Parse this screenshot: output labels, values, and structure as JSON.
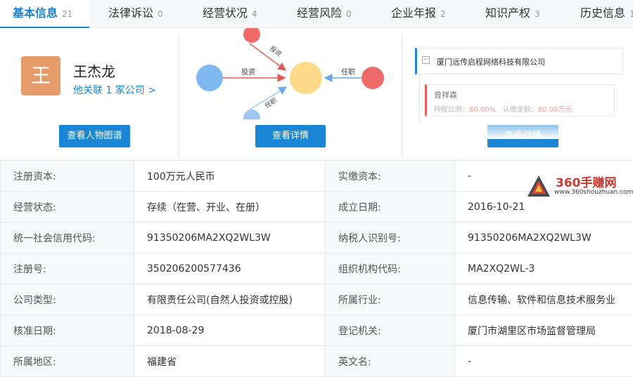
{
  "tabs": [
    {
      "label": "基本信息",
      "count": "21"
    },
    {
      "label": "法律诉讼",
      "count": "0"
    },
    {
      "label": "经营状况",
      "count": "4"
    },
    {
      "label": "经营风险",
      "count": "0"
    },
    {
      "label": "企业年报",
      "count": "2"
    },
    {
      "label": "知识产权",
      "count": "3"
    },
    {
      "label": "历史信息",
      "count": "1"
    }
  ],
  "person": {
    "avatar_char": "王",
    "name": "王杰龙",
    "link": "他关联 1 家公司 >",
    "button": "查看人物图谱"
  },
  "graph": {
    "edges": [
      "投资",
      "投资",
      "任职",
      "任职"
    ],
    "button": "查看详情"
  },
  "equity": {
    "company": "厦门远传启程网络科技有限公司",
    "holder": "曾祥森",
    "ratio_label": "持股比例：",
    "ratio_value": "80.00%",
    "amount_label": "认缴金额：",
    "amount_value": "80.00万元",
    "button": "查看详情"
  },
  "info_rows": [
    [
      "注册资本:",
      "100万元人民币",
      "实缴资本:",
      "-"
    ],
    [
      "经营状态:",
      "存续（在营、开业、在册）",
      "成立日期:",
      "2016-10-21"
    ],
    [
      "统一社会信用代码:",
      "91350206MA2XQ2WL3W",
      "纳税人识别号:",
      "91350206MA2XQ2WL3W"
    ],
    [
      "注册号:",
      "350206200577436",
      "组织机构代码:",
      "MA2XQ2WL-3"
    ],
    [
      "公司类型:",
      "有限责任公司(自然人投资或控股)",
      "所属行业:",
      "信息传输、软件和信息技术服务业"
    ],
    [
      "核准日期:",
      "2018-08-29",
      "登记机关:",
      "厦门市湖里区市场监督管理局"
    ],
    [
      "所属地区:",
      "福建省",
      "英文名:",
      "-"
    ]
  ],
  "watermark": {
    "title": "360手赚网",
    "url": "www.360shouzhuan.com"
  },
  "colors": {
    "accent": "#1b86d6",
    "avatar": "#e69b6b",
    "node_center": "#ffd98a",
    "node_blue": "#7fb8f0",
    "node_red": "#f06a6a"
  }
}
